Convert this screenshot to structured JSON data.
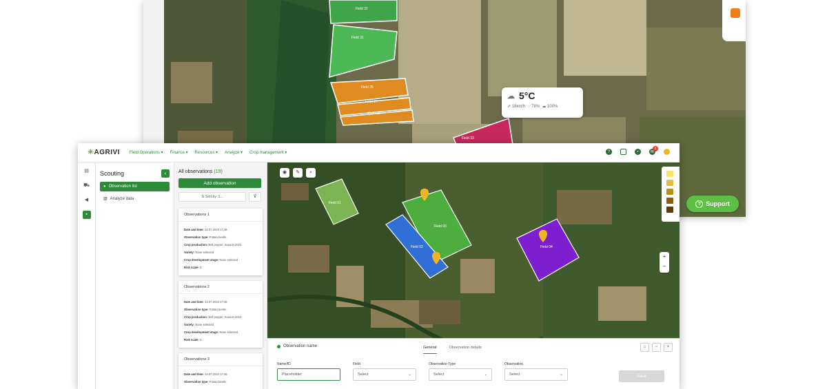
{
  "back_window": {
    "fields": [
      "Field 32",
      "Field 31",
      "Field 26",
      "Field 27",
      "Field 28",
      "Field 33"
    ],
    "weather": {
      "temp": "5°C",
      "wind": "18km/h",
      "humidity": "78%",
      "cloud": "100%"
    },
    "support_label": "Support"
  },
  "app": {
    "logo_prefix": "☀",
    "logo": "AGRIVI",
    "nav": [
      "Field Operations ▾",
      "Finance ▾",
      "Resources ▾",
      "Analyze ▾",
      "Crop management ▾"
    ],
    "notification_count": "2"
  },
  "sidebar": {
    "title": "Scouting",
    "items": [
      {
        "label": "Observation list",
        "active": true
      },
      {
        "label": "Analyze data",
        "active": false
      }
    ]
  },
  "observations": {
    "title_prefix": "All observations",
    "count": "(19)",
    "add_label": "Add observation",
    "sort_label": "Sort by: 1...",
    "cards": [
      {
        "title": "Observations 1",
        "rows": [
          {
            "k": "Date and time:",
            "v": "14.07.2023 17:46"
          },
          {
            "k": "Observation type:",
            "v": "Potato beetle"
          },
          {
            "k": "Crop production:",
            "v": "Bell pepper, Season 2023"
          },
          {
            "k": "Variety:",
            "v": "None selected"
          },
          {
            "k": "Crop development stage:",
            "v": "None selected"
          },
          {
            "k": "Risk scale:",
            "v": "5"
          }
        ]
      },
      {
        "title": "Observations 2",
        "rows": [
          {
            "k": "Date and time:",
            "v": "14.07.2023 17:46"
          },
          {
            "k": "Observation type:",
            "v": "Potato beetle"
          },
          {
            "k": "Crop production:",
            "v": "Bell pepper, Season 2023"
          },
          {
            "k": "Variety:",
            "v": "None selected"
          },
          {
            "k": "Crop development stage:",
            "v": "None selected"
          },
          {
            "k": "Risk scale:",
            "v": "5"
          }
        ]
      },
      {
        "title": "Observations 3",
        "rows": [
          {
            "k": "Date and time:",
            "v": "14.07.2023 17:46"
          },
          {
            "k": "Observation type:",
            "v": "Potato beetle"
          }
        ]
      }
    ]
  },
  "map_fields": [
    "Field 01",
    "Field 03",
    "Field 02",
    "Field 04"
  ],
  "legend_colors": [
    "#f7e26b",
    "#e2c13a",
    "#b8901b",
    "#8a5f12",
    "#5a3b0b"
  ],
  "panel": {
    "name": "Observation name",
    "tabs": [
      "General",
      "Observation details"
    ],
    "fields": [
      {
        "label": "Name/ID",
        "value": "Placeholder"
      },
      {
        "label": "Field",
        "value": "Select"
      },
      {
        "label": "Observation Type",
        "value": "Select"
      },
      {
        "label": "Observation",
        "value": "Select"
      }
    ],
    "save_label": "Save"
  }
}
